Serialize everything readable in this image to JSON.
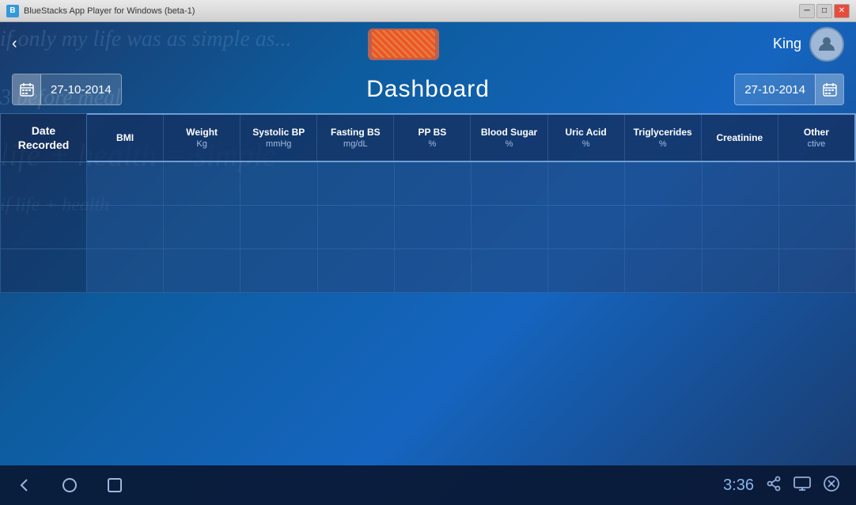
{
  "titlebar": {
    "title": "BlueStacks App Player for Windows (beta-1)",
    "icon": "B",
    "controls": {
      "minimize": "─",
      "maximize": "□",
      "close": "✕"
    }
  },
  "topbar": {
    "back_arrow": "‹",
    "username": "King"
  },
  "dashboard": {
    "title": "Dashboard",
    "date_left": "27-10-2014",
    "date_right": "27-10-2014",
    "calendar_icon": "▦"
  },
  "table": {
    "date_recorded_label": "Date Recorded",
    "columns": [
      {
        "name": "BMI",
        "unit": ""
      },
      {
        "name": "Weight",
        "unit": "Kg"
      },
      {
        "name": "Systolic BP",
        "unit": "mmHg"
      },
      {
        "name": "Fasting BS",
        "unit": "mg/dL"
      },
      {
        "name": "PP BS",
        "unit": "%"
      },
      {
        "name": "Blood Sugar",
        "unit": "%"
      },
      {
        "name": "Uric Acid",
        "unit": "%"
      },
      {
        "name": "Triglycerides",
        "unit": "%"
      },
      {
        "name": "Creatinine",
        "unit": ""
      },
      {
        "name": "Other",
        "unit": "ctive"
      }
    ],
    "rows": [
      {
        "date": ""
      },
      {
        "date": ""
      },
      {
        "date": ""
      }
    ]
  },
  "android_bar": {
    "clock": "3:36",
    "nav": {
      "back": "◁",
      "home": "○",
      "recent": "▭"
    }
  }
}
